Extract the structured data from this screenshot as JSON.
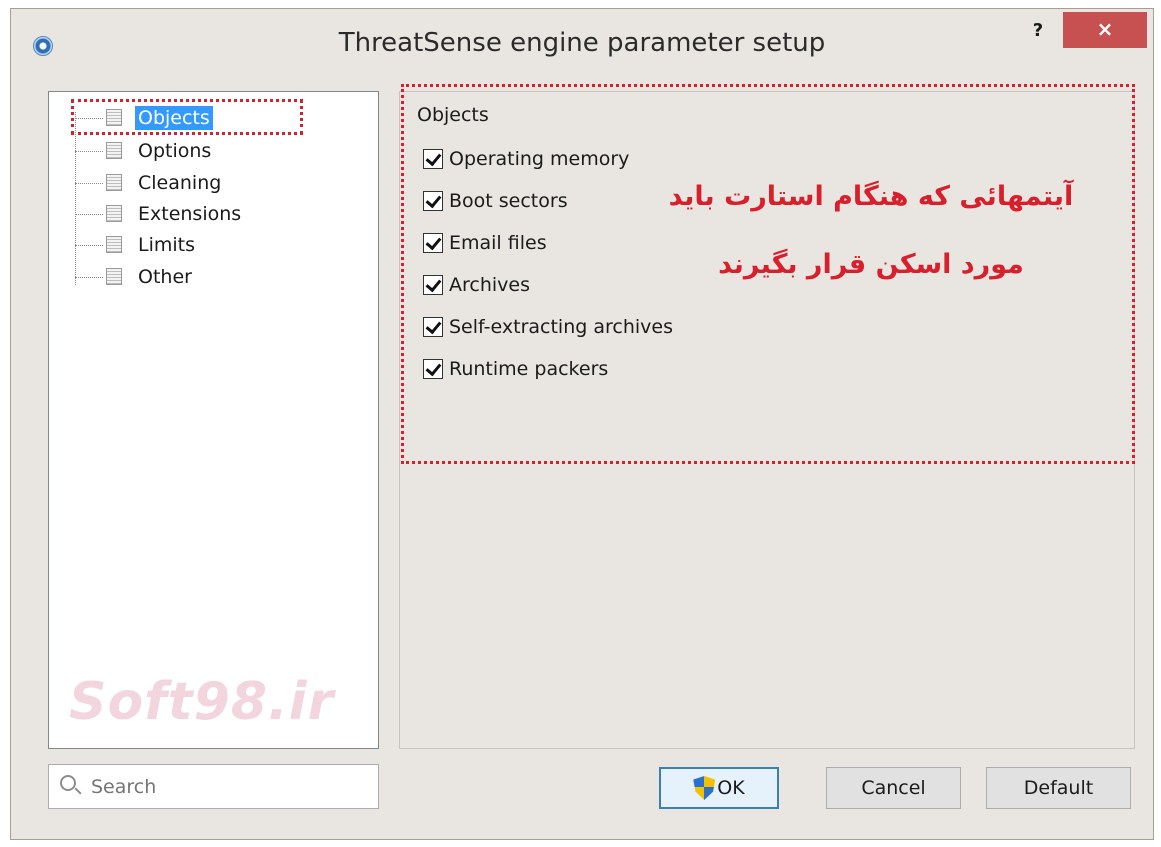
{
  "window": {
    "title": "ThreatSense engine parameter setup",
    "help_label": "?",
    "close_label": "×"
  },
  "tree": {
    "items": [
      {
        "label": "Objects",
        "selected": true
      },
      {
        "label": "Options",
        "selected": false
      },
      {
        "label": "Cleaning",
        "selected": false
      },
      {
        "label": "Extensions",
        "selected": false
      },
      {
        "label": "Limits",
        "selected": false
      },
      {
        "label": "Other",
        "selected": false
      }
    ],
    "watermark": "Soft98.ir"
  },
  "search": {
    "placeholder": "Search",
    "value": ""
  },
  "objects_group": {
    "title": "Objects",
    "options": [
      {
        "label": "Operating memory",
        "checked": true
      },
      {
        "label": "Boot sectors",
        "checked": true
      },
      {
        "label": "Email files",
        "checked": true
      },
      {
        "label": "Archives",
        "checked": true
      },
      {
        "label": "Self-extracting archives",
        "checked": true
      },
      {
        "label": "Runtime packers",
        "checked": true
      }
    ]
  },
  "annotation": {
    "line1": "آیتمهائی که هنگام استارت باید",
    "line2": "مورد اسکن قرار بگیرند",
    "color": "#d81f2b"
  },
  "buttons": {
    "ok": "OK",
    "cancel": "Cancel",
    "default": "Default"
  },
  "colors": {
    "selection": "#3399ff",
    "close_button": "#c75050",
    "highlight_outline": "#d81f2b"
  }
}
